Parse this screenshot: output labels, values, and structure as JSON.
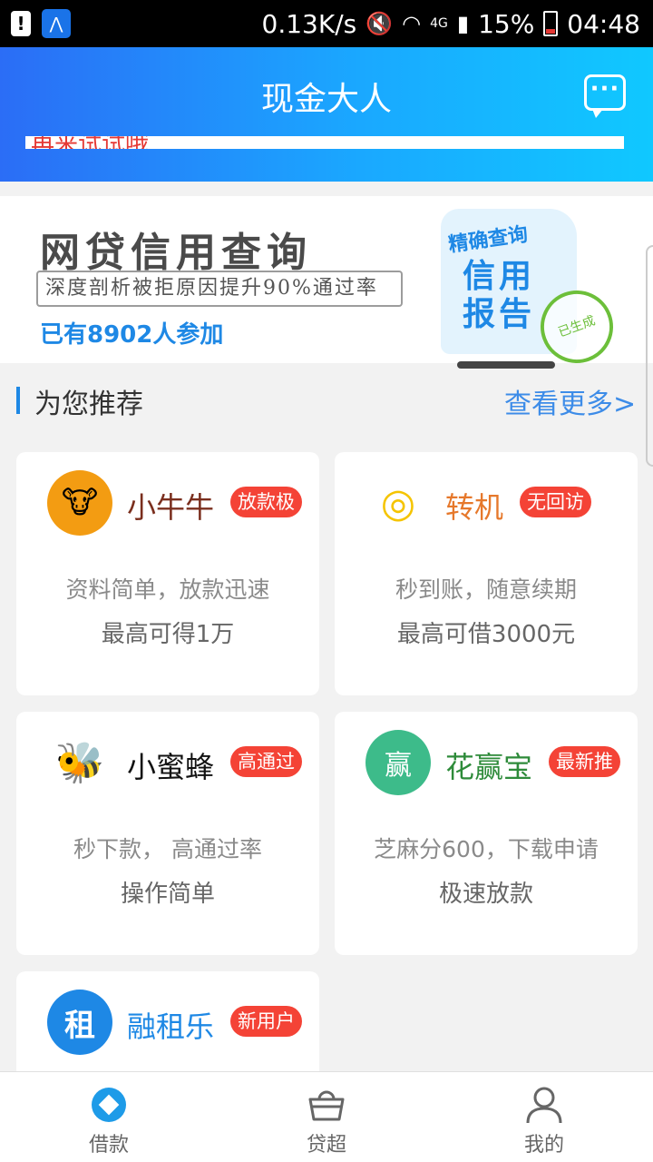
{
  "status_bar": {
    "net_speed": "0.13K/s",
    "network": "4G",
    "battery": "15%",
    "time": "04:48"
  },
  "header": {
    "title": "现金大人",
    "marquee": "再来试试哦"
  },
  "banner": {
    "title": "网贷信用查询",
    "subtitle": "深度剖析被拒原因提升90%通过率",
    "count": "已有8902人参加",
    "report_head": "精确查询",
    "report_main": "信用报告",
    "report_stamp": "已生成"
  },
  "section": {
    "title": "为您推荐",
    "more": "查看更多>"
  },
  "cards": [
    {
      "name": "小牛牛",
      "badge": "放款极",
      "line1": "资料简单，放款迅速",
      "line2": "最高可得1万",
      "name_color": "#7a2e1d"
    },
    {
      "name": "转机",
      "badge": "无回访",
      "line1": "秒到账，随意续期",
      "line2": "最高可借3000元",
      "name_color": "#e6782b"
    },
    {
      "name": "小蜜蜂",
      "badge": "高通过",
      "line1": "秒下款， 高通过率",
      "line2": "操作简单",
      "name_color": "#111111"
    },
    {
      "name": "花赢宝",
      "badge": "最新推",
      "line1": "芝麻分600，下载申请",
      "line2": "极速放款",
      "name_color": "#2e8b3a"
    },
    {
      "name": "融租乐",
      "badge": "新用户",
      "line1": "",
      "line2": "",
      "name_color": "#1e88e5"
    }
  ],
  "nav": {
    "items": [
      {
        "label": "借款",
        "icon": "diamond-icon"
      },
      {
        "label": "贷超",
        "icon": "basket-icon"
      },
      {
        "label": "我的",
        "icon": "user-icon"
      }
    ]
  },
  "colors": {
    "accent": "#1e88e5",
    "badge": "#f44336"
  }
}
